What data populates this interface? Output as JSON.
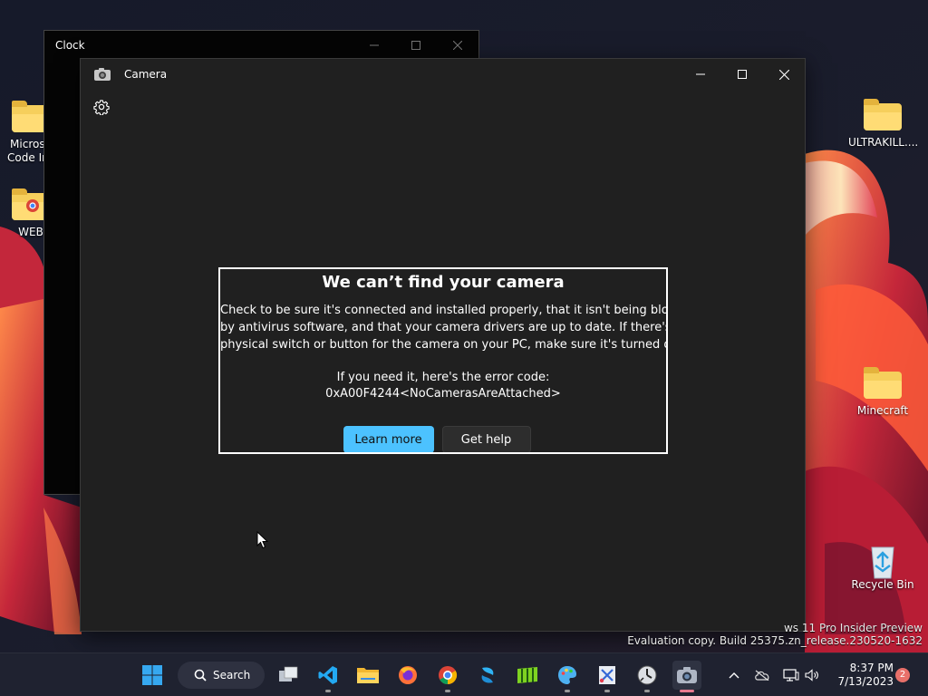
{
  "desktop": {
    "icons": [
      {
        "label_line1": "Microso",
        "label_line2": "Code Ins"
      },
      {
        "label_line1": "WEB",
        "label_line2": ""
      },
      {
        "label_line1": "ULTRAKILL....",
        "label_line2": ""
      },
      {
        "label_line1": "Minecraft",
        "label_line2": ""
      },
      {
        "label_line1": "Recycle Bin",
        "label_line2": ""
      }
    ],
    "watermark_line1": "ws 11 Pro Insider Preview",
    "watermark_line2": "Evaluation copy. Build 25375.zn_release.230520-1632"
  },
  "clock_window": {
    "title": "Clock"
  },
  "camera_window": {
    "title": "Camera",
    "error": {
      "title": "We can’t find your camera",
      "body_line1": "Check to be sure it's connected and installed properly, that it isn't being blocked",
      "body_line2": "by antivirus software, and that your camera drivers are up to date. If there's a",
      "body_line3": "physical switch or button for the camera on your PC, make sure it's turned on.",
      "code_intro": "If you need it, here's the error code:",
      "code": "0xA00F4244<NoCamerasAreAttached>",
      "learn_more": "Learn more",
      "get_help": "Get help"
    }
  },
  "taskbar": {
    "search_label": "Search",
    "time": "8:37 PM",
    "date": "7/13/2023",
    "notification_count": "2",
    "apps": [
      "start",
      "search",
      "task-view",
      "vscode",
      "file-explorer",
      "firefox",
      "chrome",
      "sharex",
      "dolphin",
      "paint",
      "snipping-tool",
      "clock",
      "camera"
    ]
  },
  "colors": {
    "accent": "#4cc2ff",
    "window_bg": "#202020",
    "taskbar_bg": "#1f2230",
    "badge": "#e8706a"
  }
}
